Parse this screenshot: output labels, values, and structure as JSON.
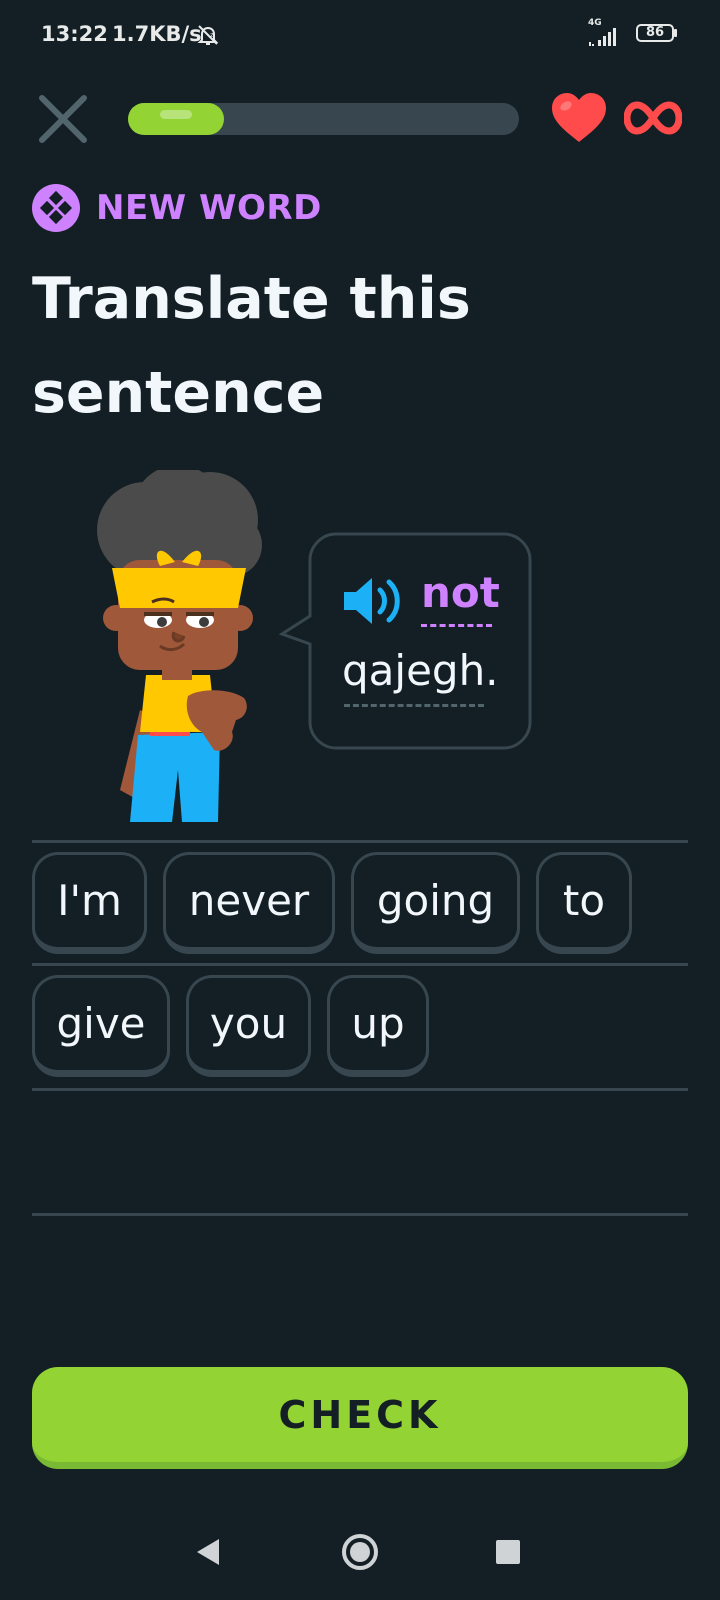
{
  "status_bar": {
    "time": "13:22",
    "speed": "1.7KB/s",
    "network": "4G",
    "battery": "86"
  },
  "lesson": {
    "progress_fraction": 0.245,
    "hearts": "∞"
  },
  "challenge": {
    "tag": "NEW WORD",
    "title_line1": "Translate this",
    "title_line2": "sentence",
    "sentence_words": [
      "not",
      "qajegh."
    ]
  },
  "word_bank": [
    "I'm",
    "never",
    "going",
    "to",
    "give",
    "you",
    "up"
  ],
  "check_label": "CHECK",
  "colors": {
    "background": "#131f24",
    "accent_green": "#93d333",
    "new_word_purple": "#ce82ff",
    "heart_red": "#ff4b4b",
    "tile_border": "#37464f"
  },
  "icons": [
    "close-icon",
    "heart-icon",
    "infinity-icon",
    "new-word-icon",
    "speaker-icon",
    "bell-muted-icon",
    "signal-icon",
    "battery-icon"
  ]
}
